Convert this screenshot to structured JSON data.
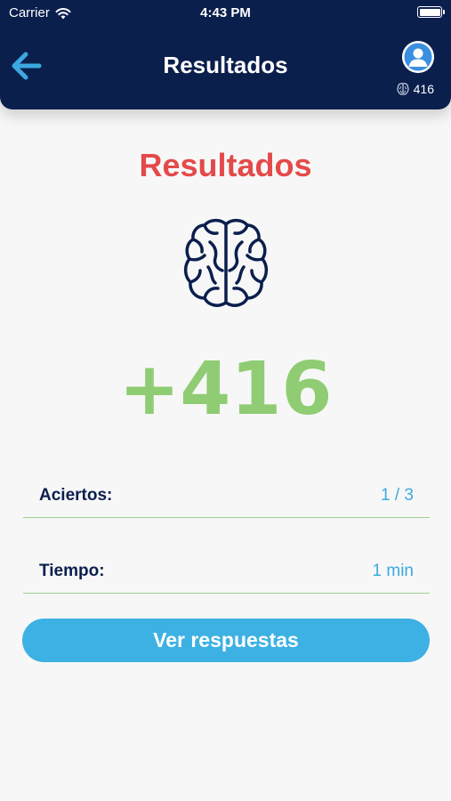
{
  "status_bar": {
    "carrier": "Carrier",
    "time": "4:43 PM"
  },
  "header": {
    "title": "Resultados",
    "score": "416"
  },
  "main": {
    "title": "Resultados",
    "points": "+416",
    "stats": [
      {
        "label": "Aciertos:",
        "value": "1 / 3"
      },
      {
        "label": "Tiempo:",
        "value": "1 min"
      }
    ],
    "action_label": "Ver respuestas"
  },
  "colors": {
    "header_bg": "#0b1f4d",
    "title_red": "#e44a4a",
    "points_green": "#8fcc73",
    "value_blue": "#3ba9e0",
    "button_blue": "#3db1e3",
    "divider_green": "#9fd08e"
  },
  "icons": [
    "wifi-icon",
    "battery-icon",
    "back-arrow-icon",
    "avatar-icon",
    "brain-icon"
  ]
}
